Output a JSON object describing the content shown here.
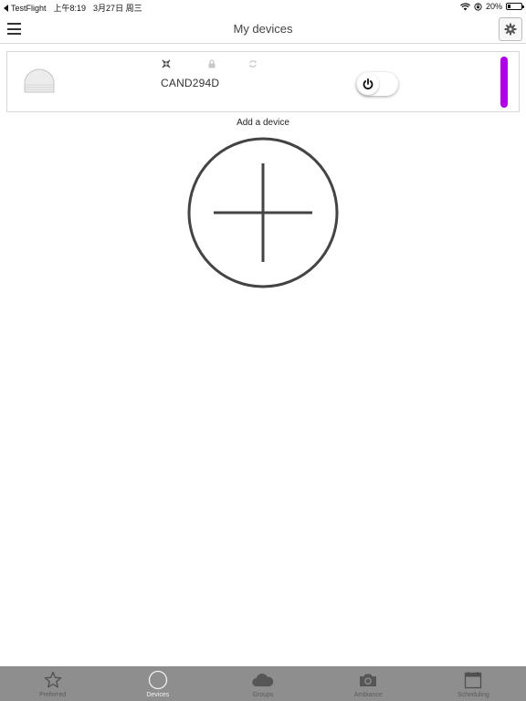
{
  "status_bar": {
    "back_app": "TestFlight",
    "time": "上午8:19",
    "date": "3月27日 周三",
    "battery": "20%",
    "battery_level": 0.2
  },
  "nav": {
    "title": "My devices"
  },
  "device": {
    "name": "CAND294D",
    "power_state": "off",
    "accent_color": "#b000e8",
    "status_icons": [
      "connection-icon",
      "lock-icon",
      "sync-icon"
    ]
  },
  "add_device": {
    "label": "Add a device"
  },
  "tabs": [
    {
      "label": "Preferred",
      "icon": "star-icon"
    },
    {
      "label": "Devices",
      "icon": "circle-icon",
      "active": true
    },
    {
      "label": "Groups",
      "icon": "cloud-icon"
    },
    {
      "label": "Ambiance",
      "icon": "camera-icon"
    },
    {
      "label": "Scheduling",
      "icon": "calendar-icon"
    }
  ]
}
